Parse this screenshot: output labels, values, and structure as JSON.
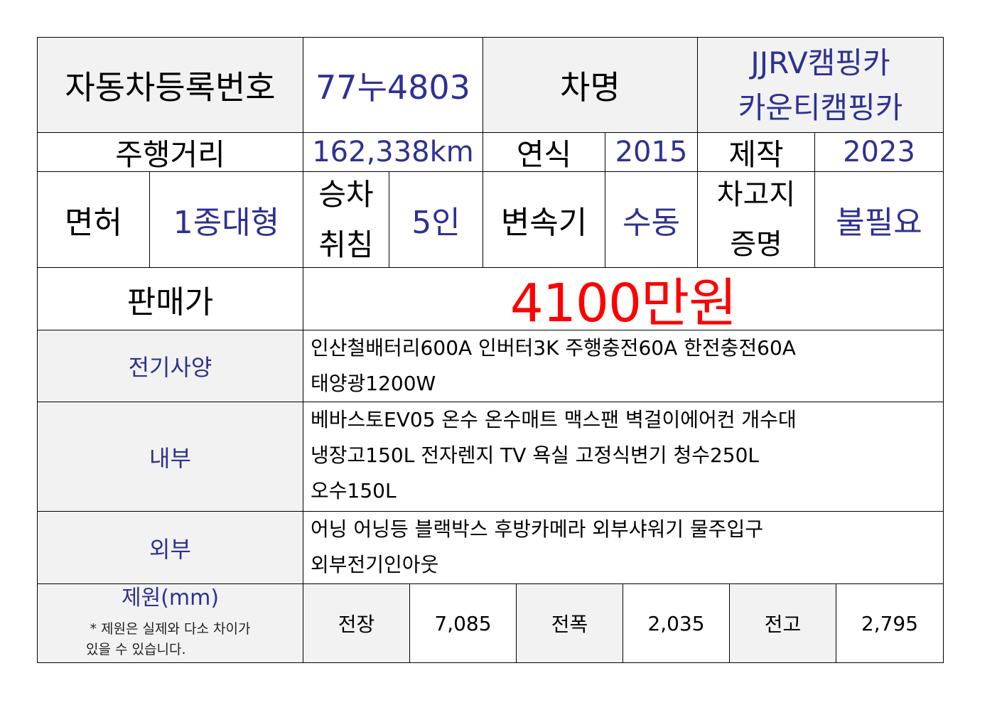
{
  "header": {
    "reg_label": "자동차등록번호",
    "reg_value": "77누4803",
    "name_label": "차명",
    "name_line1": "JJRV캠핑카",
    "name_line2": "카운티캠핑카"
  },
  "row2": {
    "mileage_label": "주행거리",
    "mileage_value": "162,338km",
    "year_label": "연식",
    "year_value": "2015",
    "made_label": "제작",
    "made_value": "2023"
  },
  "row3": {
    "license_label": "면허",
    "license_value": "1종대형",
    "seat_label_1": "승차",
    "seat_label_2": "취침",
    "seat_value": "5인",
    "trans_label": "변속기",
    "trans_value": "수동",
    "garage_label_1": "차고지",
    "garage_label_2": "증명",
    "garage_value": "불필요"
  },
  "price": {
    "label": "판매가",
    "value": "4100만원",
    "color": "#ff0000"
  },
  "electric": {
    "label": "전기사양",
    "lines": [
      "인산철배터리600A 인버터3K 주행충전60A 한전충전60A",
      "태양광1200W"
    ]
  },
  "interior": {
    "label": "내부",
    "lines": [
      "베바스토EV05 온수 온수매트 맥스팬 벽걸이에어컨 개수대",
      "냉장고150L 전자렌지 TV 욕실 고정식변기 청수250L",
      "오수150L"
    ]
  },
  "exterior": {
    "label": "외부",
    "lines": [
      "어닝 어닝등 블랙박스 후방카메라 외부샤워기 물주입구",
      "외부전기인아웃"
    ]
  },
  "specs": {
    "label": "제원(mm)",
    "note_1": "* 제원은 실제와 다소 차이가",
    "note_2": "있을 수 있습니다.",
    "length_label": "전장",
    "length_value": "7,085",
    "width_label": "전폭",
    "width_value": "2,035",
    "height_label": "전고",
    "height_value": "2,795"
  },
  "colors": {
    "value_blue": "#2e3192",
    "label_grey_bg": "#f2f2f2",
    "price_red": "#ff0000"
  }
}
